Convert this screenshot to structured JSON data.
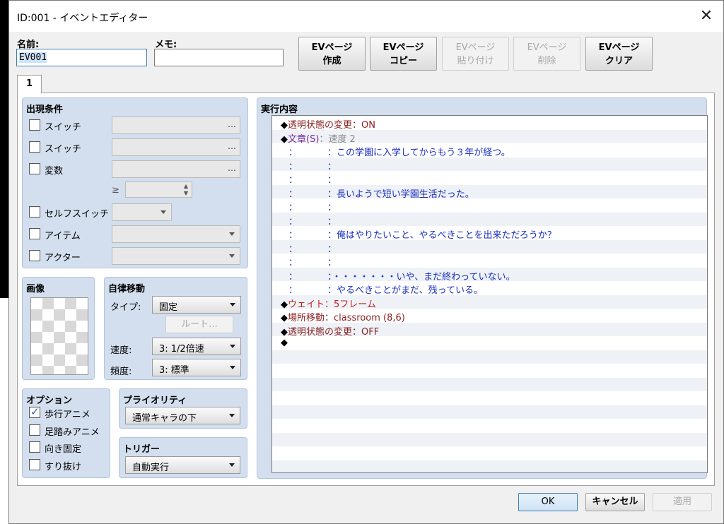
{
  "window": {
    "title": "ID:001 - イベントエディター"
  },
  "fields": {
    "name_label": "名前:",
    "name_value": "EV001",
    "memo_label": "メモ:",
    "memo_value": ""
  },
  "page_buttons": [
    {
      "line1": "EVページ",
      "line2": "作成",
      "enabled": true
    },
    {
      "line1": "EVページ",
      "line2": "コピー",
      "enabled": true
    },
    {
      "line1": "EVページ",
      "line2": "貼り付け",
      "enabled": false
    },
    {
      "line1": "EVページ",
      "line2": "削除",
      "enabled": false
    },
    {
      "line1": "EVページ",
      "line2": "クリア",
      "enabled": true
    }
  ],
  "tabs": [
    {
      "label": "1"
    }
  ],
  "conditions": {
    "title": "出現条件",
    "switch1": "スイッチ",
    "switch2": "スイッチ",
    "variable": "変数",
    "compare": "≥",
    "self_switch": "セルフスイッチ",
    "item": "アイテム",
    "actor": "アクター",
    "dots": "…"
  },
  "image": {
    "title": "画像"
  },
  "movement": {
    "title": "自律移動",
    "type_label": "タイプ:",
    "type_value": "固定",
    "route_button": "ルート...",
    "speed_label": "速度:",
    "speed_value": "3: 1/2倍速",
    "freq_label": "頻度:",
    "freq_value": "3: 標準"
  },
  "options": {
    "title": "オプション",
    "walk": "歩行アニメ",
    "step": "足踏みアニメ",
    "dirfix": "向き固定",
    "through": "すり抜け",
    "walk_checked": true
  },
  "priority": {
    "title": "プライオリティ",
    "value": "通常キャラの下"
  },
  "trigger": {
    "title": "トリガー",
    "value": "自動実行"
  },
  "contents": {
    "title": "実行内容",
    "rows": [
      {
        "kind": "cmd",
        "parts": [
          [
            "◆",
            "black"
          ],
          [
            "透明状態の変更：ON",
            "darkred"
          ]
        ]
      },
      {
        "kind": "cmd",
        "parts": [
          [
            "◆",
            "black"
          ],
          [
            "文章(S)",
            "purple"
          ],
          [
            "：速度 2",
            "gray"
          ]
        ]
      },
      {
        "kind": "text",
        "text": "：この学園に入学してからもう３年が経つ。"
      },
      {
        "kind": "text",
        "text": "："
      },
      {
        "kind": "text",
        "text": "："
      },
      {
        "kind": "text",
        "text": "：長いようで短い学園生活だった。"
      },
      {
        "kind": "text",
        "text": "："
      },
      {
        "kind": "text",
        "text": "："
      },
      {
        "kind": "text",
        "text": "：俺はやりたいこと、やるべきことを出来ただろうか？"
      },
      {
        "kind": "text",
        "text": "："
      },
      {
        "kind": "text",
        "text": "："
      },
      {
        "kind": "text",
        "text": "：・・・・・・・いや、まだ終わっていない。"
      },
      {
        "kind": "text",
        "text": "：やるべきことがまだ、残っている。"
      },
      {
        "kind": "cmd",
        "parts": [
          [
            "◆",
            "black"
          ],
          [
            "ウェイト：5フレーム",
            "red"
          ]
        ]
      },
      {
        "kind": "cmd",
        "parts": [
          [
            "◆",
            "black"
          ],
          [
            "場所移動：classroom (8,6)",
            "darkred"
          ]
        ]
      },
      {
        "kind": "cmd",
        "parts": [
          [
            "◆",
            "black"
          ],
          [
            "透明状態の変更：OFF",
            "darkred"
          ]
        ]
      },
      {
        "kind": "cmd",
        "parts": [
          [
            "◆",
            "black"
          ]
        ]
      }
    ]
  },
  "footer": {
    "ok": "OK",
    "cancel": "キャンセル",
    "apply": "適用"
  }
}
